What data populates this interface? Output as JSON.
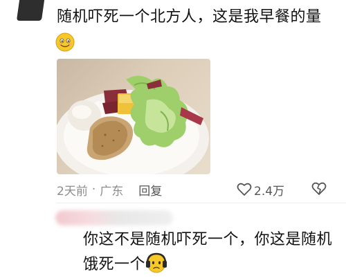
{
  "post": {
    "text": "随机吓死一个北方人，这是我早餐的量",
    "emoji": "smiling-face-icon"
  },
  "photo": {
    "description_icon": "breakfast-plate-image"
  },
  "meta": {
    "time": "2天前",
    "separator": "·",
    "location": "广东",
    "reply_label": "回复",
    "like_count": "2.4万"
  },
  "reply": {
    "text_line": "你这不是随机吓死一个，你这是随机饿死一个",
    "emoji": "scared-face-icon"
  }
}
